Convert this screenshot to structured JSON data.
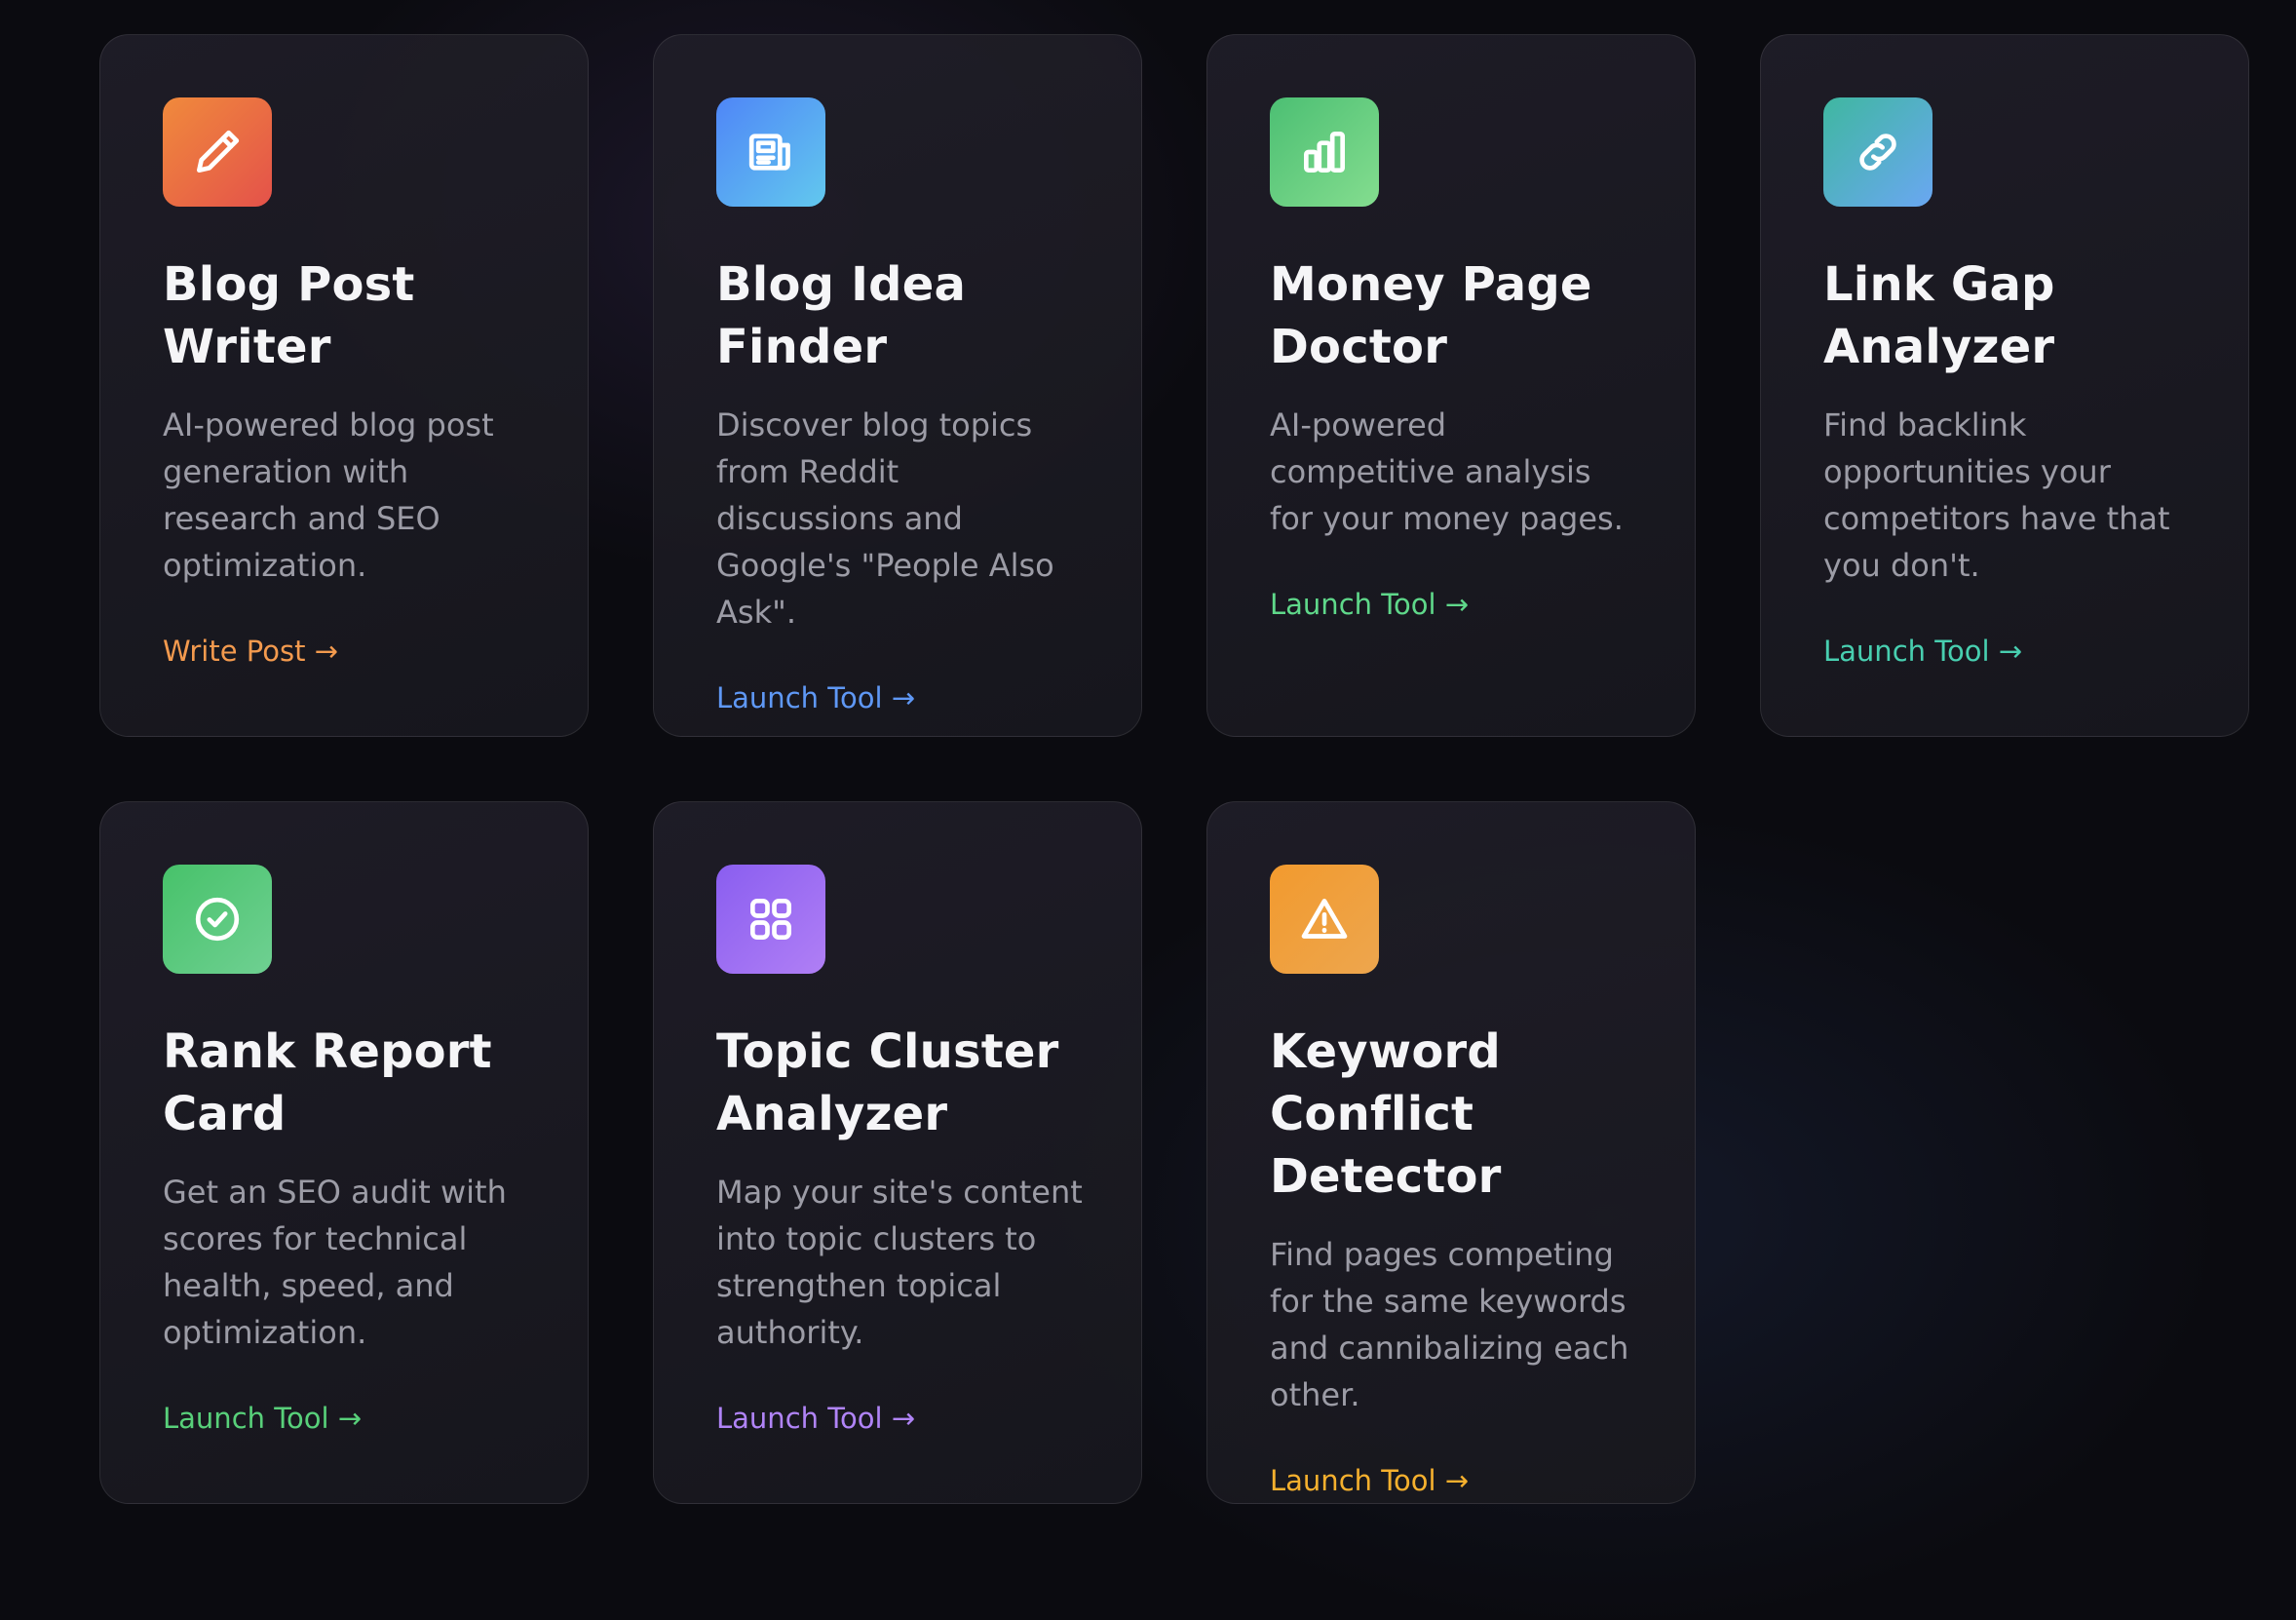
{
  "cards": [
    {
      "title": "Blog Post Writer",
      "description": "AI-powered blog post generation with research and SEO optimization.",
      "link_label": "Write Post →",
      "icon": "pencil-icon",
      "gradient": [
        "#f08a3c",
        "#e4524a"
      ],
      "link_color": "#f39a4e"
    },
    {
      "title": "Blog Idea Finder",
      "description": "Discover blog topics from Reddit discussions and Google's \"People Also Ask\".",
      "link_label": "Launch Tool →",
      "icon": "newspaper-icon",
      "gradient": [
        "#4f86f7",
        "#62c8ee"
      ],
      "link_color": "#5f98f5"
    },
    {
      "title": "Money Page Doctor",
      "description": "AI-powered competitive analysis for your money pages.",
      "link_label": "Launch Tool →",
      "icon": "bar-chart-icon",
      "gradient": [
        "#4cbf73",
        "#84dd8f"
      ],
      "link_color": "#5fd88a"
    },
    {
      "title": "Link Gap Analyzer",
      "description": "Find backlink opportunities your competitors have that you don't.",
      "link_label": "Launch Tool →",
      "icon": "link-icon",
      "gradient": [
        "#3fb7a0",
        "#6aa7f2"
      ],
      "link_color": "#48cfb0"
    },
    {
      "title": "Rank Report Card",
      "description": "Get an SEO audit with scores for technical health, speed, and optimization.",
      "link_label": "Launch Tool →",
      "icon": "check-circle-icon",
      "gradient": [
        "#47c26a",
        "#6fd092"
      ],
      "link_color": "#58d07a"
    },
    {
      "title": "Topic Cluster Analyzer",
      "description": "Map your site's content into topic clusters to strengthen topical authority.",
      "link_label": "Launch Tool →",
      "icon": "grid-icon",
      "gradient": [
        "#8a5ef0",
        "#b07ff5"
      ],
      "link_color": "#b084f7"
    },
    {
      "title": "Keyword Conflict Detector",
      "description": "Find pages competing for the same keywords and cannibalizing each other.",
      "link_label": "Launch Tool →",
      "icon": "warning-triangle-icon",
      "gradient": [
        "#f29a2e",
        "#eda64e"
      ],
      "link_color": "#f5b02e"
    }
  ]
}
